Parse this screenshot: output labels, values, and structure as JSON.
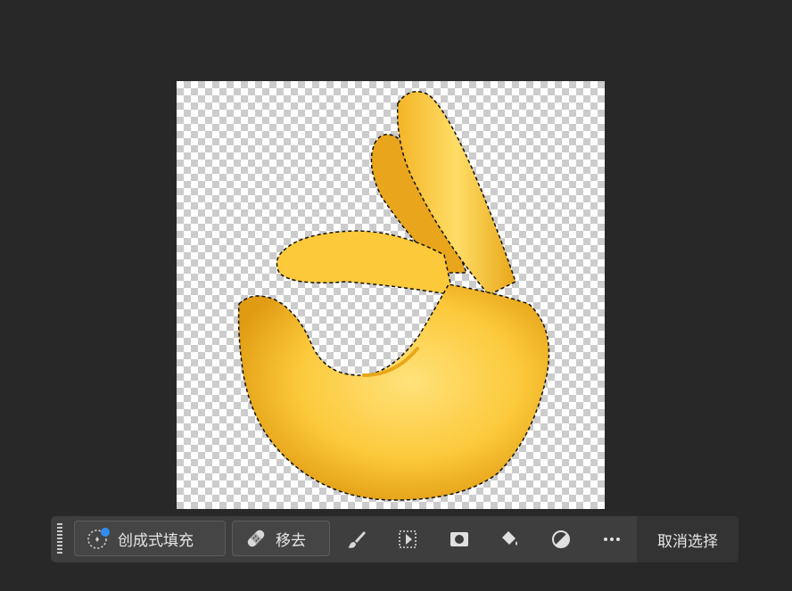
{
  "canvas": {
    "image_description_icon": "ok-hand-emoji"
  },
  "taskbar": {
    "generative_fill_label": "创成式填充",
    "remove_label": "移去",
    "tools": [
      {
        "icon": "brush-icon"
      },
      {
        "icon": "select-subject-icon"
      },
      {
        "icon": "mask-icon"
      },
      {
        "icon": "paint-bucket-icon"
      },
      {
        "icon": "adjustment-icon"
      },
      {
        "icon": "more-icon"
      }
    ],
    "deselect_label": "取消选择"
  },
  "colors": {
    "background": "#282828",
    "taskbar": "#3e3e3e",
    "accent_dot": "#2f8ef0",
    "hand_main": "#fbc02d",
    "hand_light": "#ffe082",
    "hand_shadow": "#d68910"
  }
}
